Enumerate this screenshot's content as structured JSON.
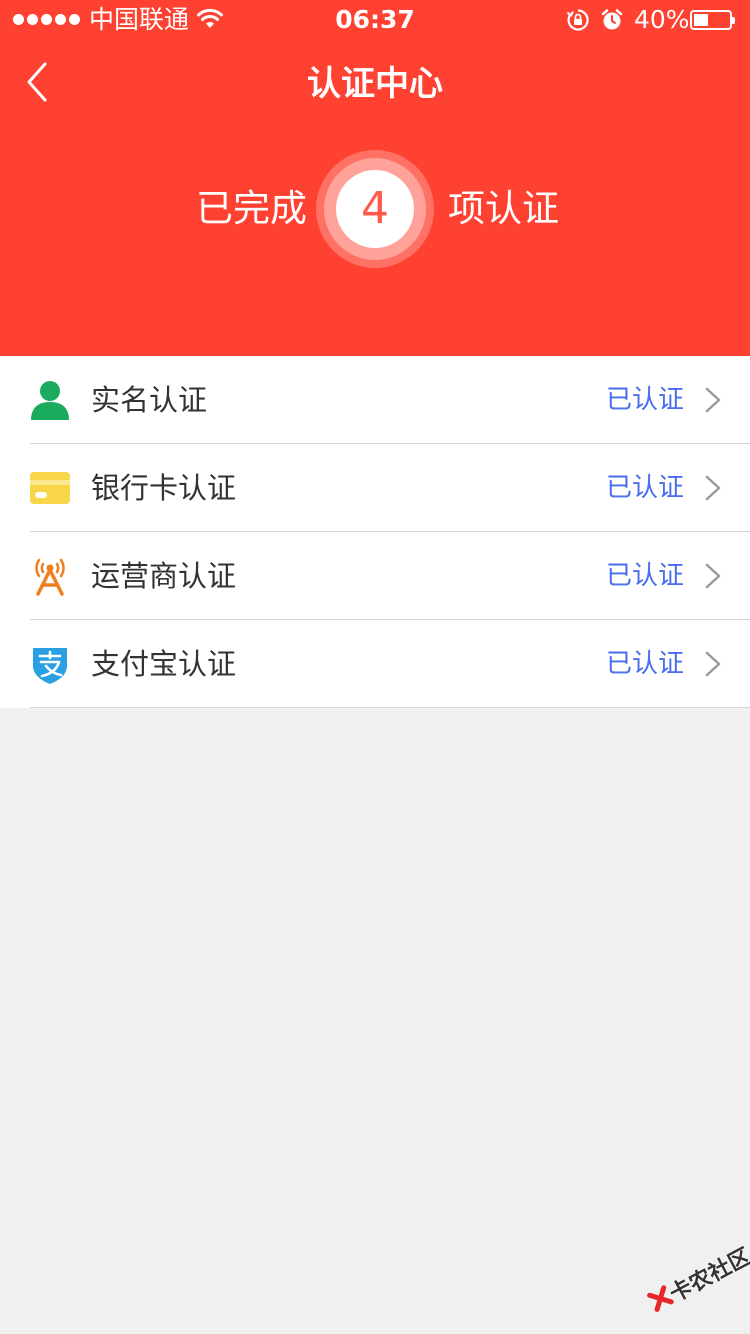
{
  "status_bar": {
    "carrier": "中国联通",
    "time": "06:37",
    "battery_percent": "40%",
    "battery_level": 0.4
  },
  "nav": {
    "title": "认证中心",
    "back_icon": "chevron-left-icon"
  },
  "summary": {
    "prefix": "已完成",
    "count": "4",
    "suffix": "项认证"
  },
  "items": [
    {
      "label": "实名认证",
      "status": "已认证",
      "icon": "person-icon",
      "color": "#1aab5f"
    },
    {
      "label": "银行卡认证",
      "status": "已认证",
      "icon": "bank-card-icon",
      "color": "#f7d64a"
    },
    {
      "label": "运营商认证",
      "status": "已认证",
      "icon": "signal-tower-icon",
      "color": "#f07e1e"
    },
    {
      "label": "支付宝认证",
      "status": "已认证",
      "icon": "alipay-shield-icon",
      "color": "#2b9fe3"
    }
  ],
  "watermark": {
    "text": "卡农社区"
  },
  "colors": {
    "header_bg": "#ff4132",
    "status_text": "#4a6cf0",
    "page_bg": "#f0f0f0"
  }
}
